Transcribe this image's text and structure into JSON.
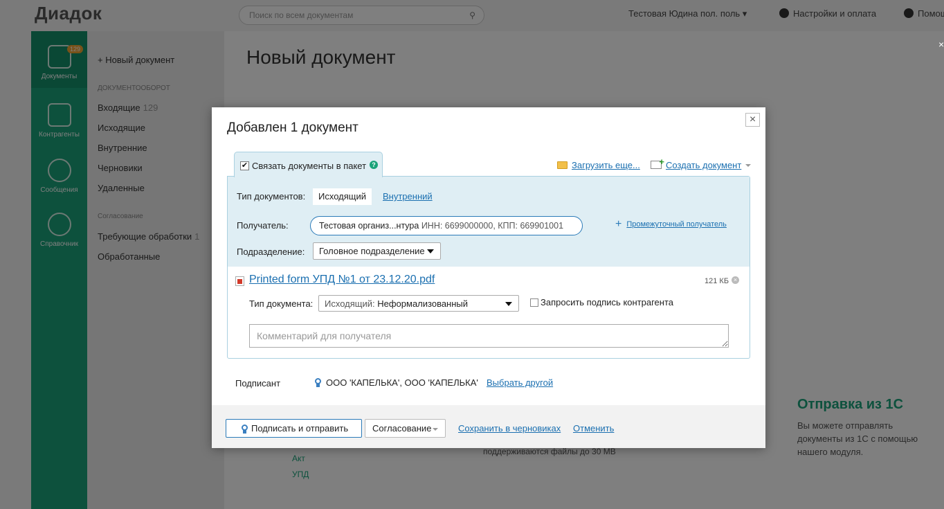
{
  "background": {
    "logo": "Диадок",
    "search_placeholder": "Поиск по всем документам",
    "user_menu": "Тестовая Юдина пол. поль",
    "settings_label": "Настройки и оплата",
    "help_label": "Помощь",
    "rail": [
      {
        "label": "Документы",
        "badge": "129"
      },
      {
        "label": "Контрагенты"
      },
      {
        "label": "Сообщения"
      },
      {
        "label": "Справочник"
      }
    ],
    "nav": {
      "new_document": "Новый документ",
      "section_documents": "ДОКУМЕНТООБОРОТ",
      "items": [
        {
          "label": "Входящие",
          "count": "129"
        },
        {
          "label": "Исходящие"
        },
        {
          "label": "Внутренние"
        },
        {
          "label": "Черновики"
        },
        {
          "label": "Удаленные"
        }
      ],
      "section_approval": "Согласование",
      "approval_items": [
        {
          "label": "Требующие обработки",
          "count": "1"
        },
        {
          "label": "Обработанные"
        }
      ]
    },
    "page_title": "Новый документ",
    "send_1c_title": "Отправка из 1С",
    "send_1c_text": "Вы можете отправлять документы из 1С с помощью нашего модуля.",
    "small_links": [
      "Акт",
      "УПД"
    ],
    "note": "поддерживаются файлы до 30 MB"
  },
  "modal": {
    "title": "Добавлен 1 документ",
    "close": "×",
    "bundle_tab": {
      "label": "Связать документы в пакет",
      "checked": true,
      "help": "?"
    },
    "upload_more": "Загрузить еще...",
    "create_document": "Создать документ",
    "doc_types_label": "Тип документов:",
    "doc_type_active": "Исходящий",
    "doc_type_other": "Внутренний",
    "recipient_label": "Получатель:",
    "recipient_name": "Тестовая организ...нтура",
    "recipient_details": "ИНН: 6699000000, КПП: 669901001",
    "intermediate_recipient": "Промежуточный получатель",
    "department_label": "Подразделение:",
    "department_value": "Головное подразделение",
    "file_name": "Printed form УПД №1 от 23.12.20.pdf",
    "file_size": "121 КБ",
    "document_type_label": "Тип документа:",
    "document_type_prefix": "Исходящий:",
    "document_type_value": "Неформализованный",
    "request_signature_label": "Запросить подпись контрагента",
    "comment_placeholder": "Комментарий для получателя",
    "signer_label": "Подписант",
    "signer_name": "ООО 'КАПЕЛЬКА', ООО 'КАПЕЛЬКА'",
    "signer_change": "Выбрать другой",
    "footer": {
      "sign_send": "Подписать и отправить",
      "approval": "Согласование",
      "save_draft": "Сохранить в черновиках",
      "cancel": "Отменить"
    }
  },
  "colors": {
    "accent_green": "#1aa37a",
    "link_blue": "#1a6fb0",
    "panel_blue": "#dfeef4"
  }
}
